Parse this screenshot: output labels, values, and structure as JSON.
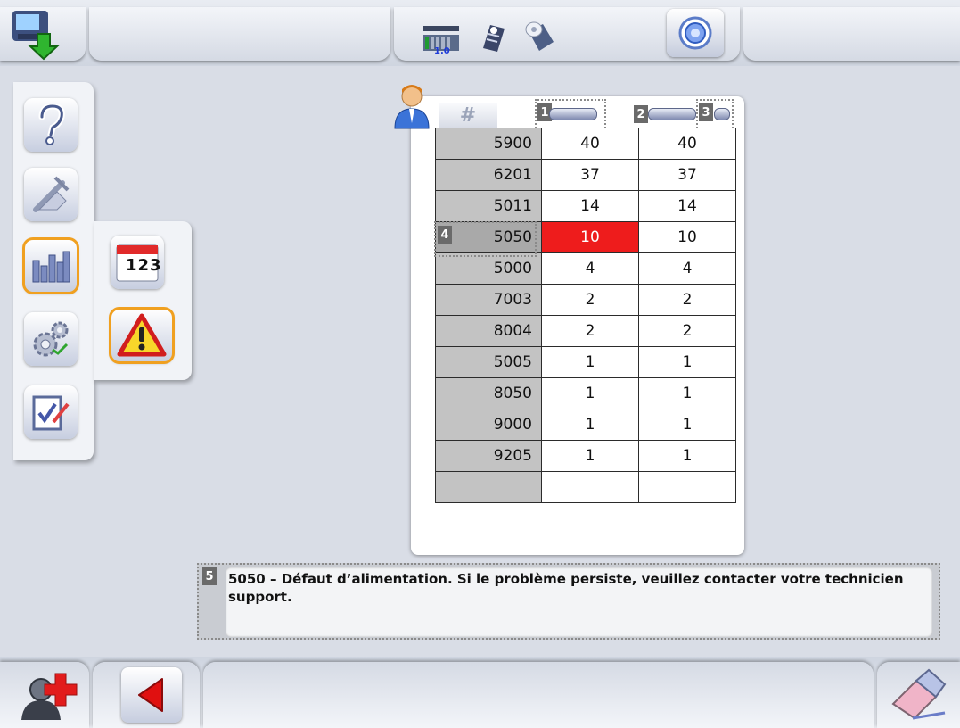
{
  "table": {
    "tags": {
      "col1": "1",
      "col2": "2",
      "col3": "3",
      "selected_row": "4",
      "message": "5"
    },
    "header": {
      "code": "#"
    },
    "rows": [
      {
        "code": "5900",
        "c1": "40",
        "c2": "40"
      },
      {
        "code": "6201",
        "c1": "37",
        "c2": "37"
      },
      {
        "code": "5011",
        "c1": "14",
        "c2": "14"
      },
      {
        "code": "5050",
        "c1": "10",
        "c2": "10"
      },
      {
        "code": "5000",
        "c1": "4",
        "c2": "4"
      },
      {
        "code": "7003",
        "c1": "2",
        "c2": "2"
      },
      {
        "code": "8004",
        "c1": "2",
        "c2": "2"
      },
      {
        "code": "5005",
        "c1": "1",
        "c2": "1"
      },
      {
        "code": "8050",
        "c1": "1",
        "c2": "1"
      },
      {
        "code": "9000",
        "c1": "1",
        "c2": "1"
      },
      {
        "code": "9205",
        "c1": "1",
        "c2": "1"
      },
      {
        "code": "",
        "c1": "",
        "c2": ""
      }
    ]
  },
  "topbar": {
    "version_label": "1.0"
  },
  "calendar_icon_digits": "123",
  "message": {
    "text": "5050 – Défaut d’alimentation. Si le problème persiste, veuillez contacter votre technicien support."
  },
  "colors": {
    "accent_orange": "#f0a020",
    "highlight_red": "#ee1c1c",
    "back_arrow_red": "#e01010"
  },
  "icons": {
    "top": [
      "download-manual-icon",
      "film-version-icon",
      "banknote-icon",
      "roll-icon",
      "target-button-icon"
    ],
    "sidebar": [
      "help-icon",
      "tools-icon",
      "statistics-icon",
      "settings-gears-icon",
      "checklist-icon"
    ],
    "submenu": [
      "calendar-counter-icon",
      "warning-icon"
    ],
    "bottom": [
      "user-medical-icon",
      "back-arrow-icon",
      "eraser-icon"
    ]
  }
}
